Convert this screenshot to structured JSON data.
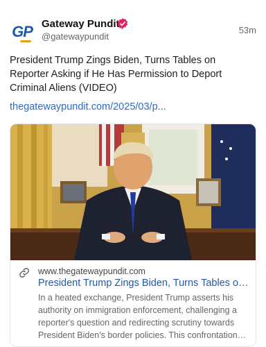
{
  "post": {
    "author": {
      "name": "Gateway Pundit",
      "handle": "@gatewaypundit",
      "avatar_text": "GP",
      "verified": true
    },
    "timestamp": "53m",
    "text": "President Trump Zings Biden, Turns Tables on Reporter Asking if He Has Permission to Deport Criminal Aliens (VIDEO)",
    "link_text": "thegatewaypundit.com/2025/03/p...",
    "card": {
      "domain": "www.thegatewaypundit.com",
      "title": "President Trump Zings Biden, Turns Tables on Reporter Asking if He Has Permission to Deport Criminal Aliens (VIDEO)",
      "description": "In a heated exchange, President Trump asserts his authority on immigration enforcement, challenging a reporter's question and redirecting scrutiny towards President Biden's border policies. This confrontation o...",
      "link_icon": "link-icon"
    }
  },
  "colors": {
    "brand_blue": "#1f5aa6",
    "link_blue": "#2a6ac7",
    "verified_red": "#e0245e",
    "muted_text": "#666666"
  }
}
